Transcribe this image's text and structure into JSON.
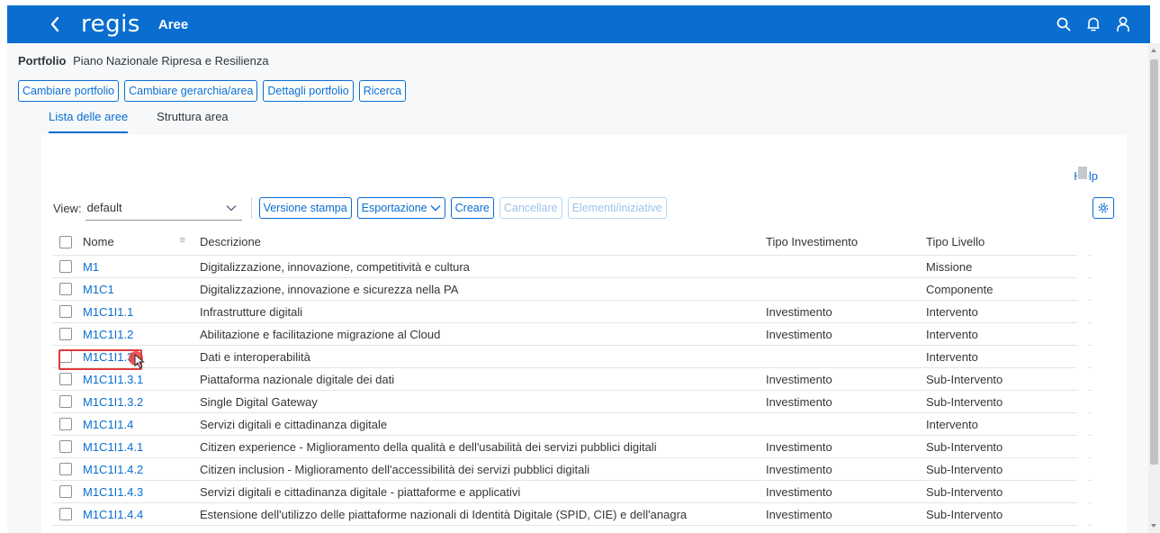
{
  "shell": {
    "logo": "regis",
    "title": "Aree"
  },
  "portfolio": {
    "label": "Portfolio",
    "value": "Piano Nazionale Ripresa e Resilienza"
  },
  "actions": {
    "change_portfolio": "Cambiare portfolio",
    "change_hierarchy": "Cambiare gerarchia/area",
    "portfolio_details": "Dettagli portfolio",
    "search": "Ricerca"
  },
  "tabs": {
    "list": "Lista delle aree",
    "structure": "Struttura area"
  },
  "card": {
    "help": "Help"
  },
  "toolbar": {
    "view_label": "View:",
    "view_value": "default",
    "print_version": "Versione stampa",
    "export": "Esportazione",
    "create": "Creare",
    "delete": "Cancellare",
    "elements": "Elementi/iniziative"
  },
  "table": {
    "headers": {
      "nome": "Nome",
      "descrizione": "Descrizione",
      "tipo_investimento": "Tipo Investimento",
      "tipo_livello": "Tipo Livello"
    },
    "rows": [
      {
        "nome": "M1",
        "descrizione": "Digitalizzazione, innovazione, competitività e cultura",
        "tipo": "",
        "livello": "Missione"
      },
      {
        "nome": "M1C1",
        "descrizione": "Digitalizzazione, innovazione e sicurezza nella PA",
        "tipo": "",
        "livello": "Componente"
      },
      {
        "nome": "M1C1I1.1",
        "descrizione": "Infrastrutture digitali",
        "tipo": "Investimento",
        "livello": "Intervento"
      },
      {
        "nome": "M1C1I1.2",
        "descrizione": "Abilitazione e facilitazione migrazione al Cloud",
        "tipo": "Investimento",
        "livello": "Intervento"
      },
      {
        "nome": "M1C1I1.3",
        "descrizione": "Dati e interoperabilità",
        "tipo": "",
        "livello": "Intervento"
      },
      {
        "nome": "M1C1I1.3.1",
        "descrizione": "Piattaforma nazionale digitale dei dati",
        "tipo": "Investimento",
        "livello": "Sub-Intervento"
      },
      {
        "nome": "M1C1I1.3.2",
        "descrizione": " Single Digital Gateway",
        "tipo": "Investimento",
        "livello": "Sub-Intervento"
      },
      {
        "nome": "M1C1I1.4",
        "descrizione": "Servizi digitali e cittadinanza digitale",
        "tipo": "",
        "livello": "Intervento"
      },
      {
        "nome": "M1C1I1.4.1",
        "descrizione": "Citizen experience - Miglioramento della qualità e dell'usabilità dei servizi pubblici digitali",
        "tipo": "Investimento",
        "livello": "Sub-Intervento"
      },
      {
        "nome": "M1C1I1.4.2",
        "descrizione": "Citizen inclusion - Miglioramento dell'accessibilità dei servizi pubblici digitali",
        "tipo": "Investimento",
        "livello": "Sub-Intervento"
      },
      {
        "nome": "M1C1I1.4.3",
        "descrizione": "Servizi digitali e cittadinanza digitale - piattaforme e applicativi",
        "tipo": "Investimento",
        "livello": "Sub-Intervento"
      },
      {
        "nome": "M1C1I1.4.4",
        "descrizione": " Estensione dell'utilizzo delle piattaforme nazionali di Identità Digitale (SPID, CIE) e dell'anagra",
        "tipo": "Investimento",
        "livello": "Sub-Intervento"
      }
    ]
  },
  "colors": {
    "shell": "#0a6ed1",
    "link": "#0a6ed1",
    "highlight": "#e03a3a"
  }
}
